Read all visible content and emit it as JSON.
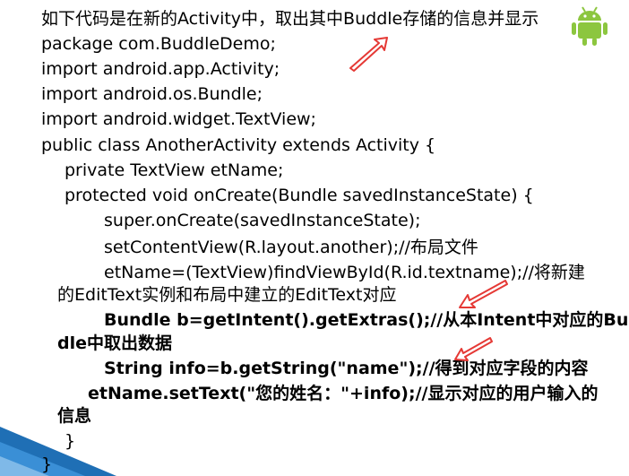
{
  "slide": {
    "lines": [
      "如下代码是在新的Activity中，取出其中Buddle存储的信息并显示",
      "package com.BuddleDemo;",
      "import android.app.Activity;",
      "import android.os.Bundle;",
      "import android.widget.TextView;",
      "public class AnotherActivity extends Activity {",
      "private TextView etName;",
      "protected void onCreate(Bundle savedInstanceState) {",
      "super.onCreate(savedInstanceState);",
      "setContentView(R.layout.another);//布局文件",
      "etName=(TextView)findViewById(R.id.textname);//将新建",
      "的EditText实例和布局中建立的EditText对应",
      "Bundle b=getIntent().getExtras();//从本Intent中对应的Bud",
      "dle中取出数据",
      "String info=b.getString(\"name\");//得到对应字段的内容",
      "etName.setText(\"您的姓名：\"+info);//显示对应的用户输入的",
      "信息",
      "}",
      "}"
    ]
  },
  "colors": {
    "arrow": "#e53935",
    "arrow_fill": "#ffffff",
    "decor": "#3a8fd6",
    "robot": "#8cc63f"
  },
  "icons": {
    "robot": "android-robot-icon",
    "arrow": "red-arrow-icon"
  }
}
